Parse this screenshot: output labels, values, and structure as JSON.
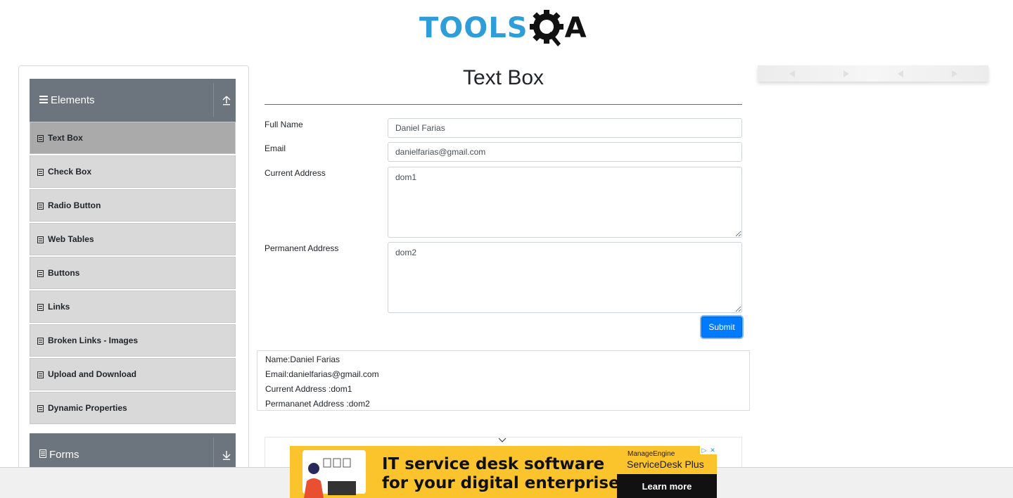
{
  "header": {
    "logo_tools": "TOOLS",
    "logo_a": "A",
    "logo_alt": "TOOLSQA"
  },
  "sidebar": {
    "groups": [
      {
        "label": "Elements",
        "expanded": true
      },
      {
        "label": "Forms",
        "expanded": false
      }
    ],
    "items": [
      {
        "label": "Text Box",
        "active": true
      },
      {
        "label": "Check Box"
      },
      {
        "label": "Radio Button"
      },
      {
        "label": "Web Tables"
      },
      {
        "label": "Buttons"
      },
      {
        "label": "Links"
      },
      {
        "label": "Broken Links - Images"
      },
      {
        "label": "Upload and Download"
      },
      {
        "label": "Dynamic Properties"
      }
    ]
  },
  "main": {
    "title": "Text Box",
    "form": {
      "full_name_label": "Full Name",
      "full_name_value": "Daniel Farias",
      "email_label": "Email",
      "email_value": "danielfarias@gmail.com",
      "current_address_label": "Current Address",
      "current_address_value": "dom1",
      "permanent_address_label": "Permanent Address",
      "permanent_address_value": "dom2",
      "submit_label": "Submit"
    },
    "output": {
      "name": "Name:Daniel Farias",
      "email": "Email:danielfarias@gmail.com",
      "current_address": "Current Address :dom1",
      "permanent_address": "Permananet Address :dom2"
    }
  },
  "ad": {
    "line1": "IT service desk software",
    "line2": "for your digital enterprise",
    "brand": "ManageEngine",
    "product": "ServiceDesk Plus",
    "cta": "Learn more"
  },
  "colors": {
    "brand_blue": "#2f9ed8",
    "sidebar_header": "#6c757d",
    "menu_item": "#d9d9d9",
    "menu_item_active": "#aaaaaa",
    "submit_button": "#007bff",
    "ad_background": "#fcc42c"
  },
  "icons": {
    "group_elements": "hamburger-icon",
    "group_forms": "document-icon",
    "collapse": "arrow-up-icon",
    "expand": "arrow-down-icon",
    "menu_item": "list-icon"
  }
}
